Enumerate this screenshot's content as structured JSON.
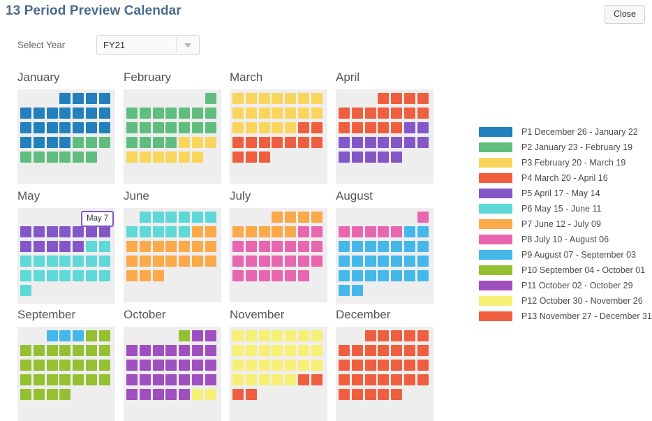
{
  "header": {
    "title": "13 Period Preview Calendar",
    "close_label": "Close"
  },
  "year_selector": {
    "label": "Select Year",
    "value": "FY21",
    "options": [
      "FY21"
    ],
    "arrow_icon": "chevron-down-icon"
  },
  "tooltip": {
    "visible": true,
    "text": "May 7"
  },
  "palette": {
    "p1": "#2280bd",
    "p2": "#5fbe7e",
    "p3": "#fad55c",
    "p4": "#ef5f3f",
    "p5": "#8457c8",
    "p6": "#5fd8d8",
    "p7": "#fba949",
    "p8": "#e866b0",
    "p9": "#45b8ea",
    "p10": "#95c032",
    "p11": "#a04fc0",
    "p12": "#f8f075",
    "p13": "#ef5f3f",
    "empty": "#eeeeee",
    "grid_background": "#eeeeee",
    "title": "#4a6b8a"
  },
  "legend": {
    "items": [
      {
        "code": "p1",
        "color": "#2280bd",
        "label": "P1 December 26 - January 22"
      },
      {
        "code": "p2",
        "color": "#5fbe7e",
        "label": "P2 January 23 - February 19"
      },
      {
        "code": "p3",
        "color": "#fad55c",
        "label": "P3 February 20 - March 19"
      },
      {
        "code": "p4",
        "color": "#ef5f3f",
        "label": "P4 March 20 - April 16"
      },
      {
        "code": "p5",
        "color": "#8457c8",
        "label": "P5 April 17 - May 14"
      },
      {
        "code": "p6",
        "color": "#5fd8d8",
        "label": "P6 May 15 - June 11"
      },
      {
        "code": "p7",
        "color": "#fba949",
        "label": "P7 June 12 - July 09"
      },
      {
        "code": "p8",
        "color": "#e866b0",
        "label": "P8 July 10 - August 06"
      },
      {
        "code": "p9",
        "color": "#45b8ea",
        "label": "P9 August 07 - September 03"
      },
      {
        "code": "p10",
        "color": "#95c032",
        "label": "P10 September 04 - October 01"
      },
      {
        "code": "p11",
        "color": "#a04fc0",
        "label": "P11 October 02 - October 29"
      },
      {
        "code": "p12",
        "color": "#f8f075",
        "label": "P12 October 30 - November 26"
      },
      {
        "code": "p13",
        "color": "#ef5f3f",
        "label": "P13 November 27 - December 31"
      }
    ]
  },
  "calendar": {
    "months": [
      {
        "name": "January",
        "weeks": [
          [
            "",
            "",
            "",
            "p1",
            "p1",
            "p1",
            "p1"
          ],
          [
            "p1",
            "p1",
            "p1",
            "p1",
            "p1",
            "p1",
            "p1"
          ],
          [
            "p1",
            "p1",
            "p1",
            "p1",
            "p1",
            "p1",
            "p1"
          ],
          [
            "p1",
            "p1",
            "p1",
            "p1",
            "p2",
            "p2",
            "p2"
          ],
          [
            "p2",
            "p2",
            "p2",
            "p2",
            "p2",
            "p2",
            ""
          ]
        ]
      },
      {
        "name": "February",
        "weeks": [
          [
            "",
            "",
            "",
            "",
            "",
            "",
            "p2"
          ],
          [
            "p2",
            "p2",
            "p2",
            "p2",
            "p2",
            "p2",
            "p2"
          ],
          [
            "p2",
            "p2",
            "p2",
            "p2",
            "p2",
            "p2",
            "p2"
          ],
          [
            "p2",
            "p2",
            "p2",
            "p2",
            "p3",
            "p3",
            "p3"
          ],
          [
            "p3",
            "p3",
            "p3",
            "p3",
            "p3",
            "p3",
            ""
          ]
        ]
      },
      {
        "name": "March",
        "weeks": [
          [
            "p3",
            "p3",
            "p3",
            "p3",
            "p3",
            "p3",
            "p3"
          ],
          [
            "p3",
            "p3",
            "p3",
            "p3",
            "p3",
            "p3",
            "p3"
          ],
          [
            "p3",
            "p3",
            "p3",
            "p3",
            "p3",
            "p4",
            "p4"
          ],
          [
            "p4",
            "p4",
            "p4",
            "p4",
            "p4",
            "p4",
            "p4"
          ],
          [
            "p4",
            "p4",
            "p4",
            "",
            "",
            "",
            ""
          ]
        ]
      },
      {
        "name": "April",
        "weeks": [
          [
            "",
            "",
            "",
            "p4",
            "p4",
            "p4",
            "p4"
          ],
          [
            "p4",
            "p4",
            "p4",
            "p4",
            "p4",
            "p4",
            "p4"
          ],
          [
            "p4",
            "p4",
            "p4",
            "p4",
            "p4",
            "p5",
            "p5"
          ],
          [
            "p5",
            "p5",
            "p5",
            "p5",
            "p5",
            "p5",
            "p5"
          ],
          [
            "p5",
            "p5",
            "p5",
            "p5",
            "p5",
            "",
            ""
          ]
        ]
      },
      {
        "name": "May",
        "weeks": [
          [
            "",
            "",
            "",
            "",
            "",
            "",
            "p5"
          ],
          [
            "p5",
            "p5",
            "p5",
            "p5",
            "p5",
            "p5",
            "p5"
          ],
          [
            "p5",
            "p5",
            "p5",
            "p5",
            "p5",
            "p6",
            "p6"
          ],
          [
            "p6",
            "p6",
            "p6",
            "p6",
            "p6",
            "p6",
            "p6"
          ],
          [
            "p6",
            "p6",
            "p6",
            "p6",
            "p6",
            "p6",
            "p6"
          ],
          [
            "p6",
            "",
            "",
            "",
            "",
            "",
            ""
          ]
        ]
      },
      {
        "name": "June",
        "weeks": [
          [
            "",
            "p6",
            "p6",
            "p6",
            "p6",
            "p6",
            "p6"
          ],
          [
            "p6",
            "p6",
            "p6",
            "p6",
            "p6",
            "p7",
            "p7"
          ],
          [
            "p7",
            "p7",
            "p7",
            "p7",
            "p7",
            "p7",
            "p7"
          ],
          [
            "p7",
            "p7",
            "p7",
            "p7",
            "p7",
            "p7",
            "p7"
          ],
          [
            "p7",
            "p7",
            "p7",
            "",
            "",
            "",
            ""
          ]
        ]
      },
      {
        "name": "July",
        "weeks": [
          [
            "",
            "",
            "",
            "p7",
            "p7",
            "p7",
            "p7"
          ],
          [
            "p7",
            "p7",
            "p7",
            "p7",
            "p7",
            "p8",
            "p8"
          ],
          [
            "p8",
            "p8",
            "p8",
            "p8",
            "p8",
            "p8",
            "p8"
          ],
          [
            "p8",
            "p8",
            "p8",
            "p8",
            "p8",
            "p8",
            "p8"
          ],
          [
            "p8",
            "p8",
            "p8",
            "p8",
            "p8",
            "p8",
            ""
          ]
        ]
      },
      {
        "name": "August",
        "weeks": [
          [
            "",
            "",
            "",
            "",
            "",
            "",
            "p8"
          ],
          [
            "p8",
            "p8",
            "p8",
            "p8",
            "p8",
            "p9",
            "p9"
          ],
          [
            "p9",
            "p9",
            "p9",
            "p9",
            "p9",
            "p9",
            "p9"
          ],
          [
            "p9",
            "p9",
            "p9",
            "p9",
            "p9",
            "p9",
            "p9"
          ],
          [
            "p9",
            "p9",
            "p9",
            "p9",
            "p9",
            "p9",
            "p9"
          ],
          [
            "p9",
            "p9",
            "",
            "",
            "",
            "",
            ""
          ]
        ]
      },
      {
        "name": "September",
        "weeks": [
          [
            "",
            "",
            "p9",
            "p9",
            "p9",
            "p10",
            "p10"
          ],
          [
            "p10",
            "p10",
            "p10",
            "p10",
            "p10",
            "p10",
            "p10"
          ],
          [
            "p10",
            "p10",
            "p10",
            "p10",
            "p10",
            "p10",
            "p10"
          ],
          [
            "p10",
            "p10",
            "p10",
            "p10",
            "p10",
            "p10",
            "p10"
          ],
          [
            "p10",
            "p10",
            "p10",
            "p10",
            "",
            "",
            ""
          ]
        ]
      },
      {
        "name": "October",
        "weeks": [
          [
            "",
            "",
            "",
            "",
            "p10",
            "p11",
            "p11"
          ],
          [
            "p11",
            "p11",
            "p11",
            "p11",
            "p11",
            "p11",
            "p11"
          ],
          [
            "p11",
            "p11",
            "p11",
            "p11",
            "p11",
            "p11",
            "p11"
          ],
          [
            "p11",
            "p11",
            "p11",
            "p11",
            "p11",
            "p11",
            "p11"
          ],
          [
            "p11",
            "p11",
            "p11",
            "p11",
            "p11",
            "p12",
            "p12"
          ]
        ]
      },
      {
        "name": "November",
        "weeks": [
          [
            "p12",
            "p12",
            "p12",
            "p12",
            "p12",
            "p12",
            "p12"
          ],
          [
            "p12",
            "p12",
            "p12",
            "p12",
            "p12",
            "p12",
            "p12"
          ],
          [
            "p12",
            "p12",
            "p12",
            "p12",
            "p12",
            "p12",
            "p12"
          ],
          [
            "p12",
            "p12",
            "p12",
            "p12",
            "p12",
            "p13",
            "p13"
          ],
          [
            "p13",
            "p13",
            "",
            "",
            "",
            "",
            ""
          ]
        ]
      },
      {
        "name": "December",
        "weeks": [
          [
            "",
            "",
            "p13",
            "p13",
            "p13",
            "p13",
            "p13"
          ],
          [
            "p13",
            "p13",
            "p13",
            "p13",
            "p13",
            "p13",
            "p13"
          ],
          [
            "p13",
            "p13",
            "p13",
            "p13",
            "p13",
            "p13",
            "p13"
          ],
          [
            "p13",
            "p13",
            "p13",
            "p13",
            "p13",
            "p13",
            "p13"
          ],
          [
            "p13",
            "p13",
            "p13",
            "p13",
            "p13",
            "",
            ""
          ]
        ]
      }
    ]
  }
}
